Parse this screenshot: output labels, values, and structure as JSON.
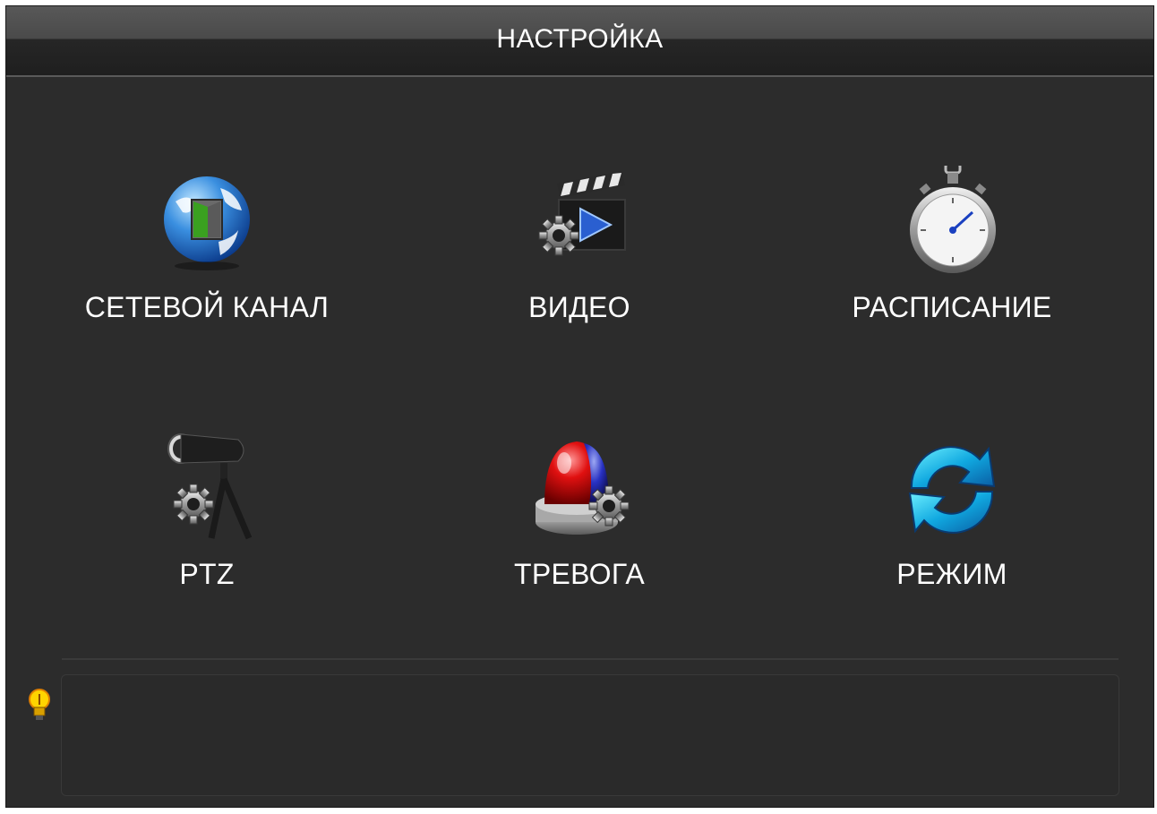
{
  "window": {
    "title": "НАСТРОЙКА"
  },
  "menu": {
    "items": [
      {
        "label": "СЕТЕВОЙ КАНАЛ",
        "icon": "network-globe-icon"
      },
      {
        "label": "ВИДЕО",
        "icon": "video-clapper-gear-icon"
      },
      {
        "label": "РАСПИСАНИЕ",
        "icon": "stopwatch-icon"
      },
      {
        "label": "PTZ",
        "icon": "ptz-camera-gear-icon"
      },
      {
        "label": "ТРЕВОГА",
        "icon": "alarm-siren-gear-icon"
      },
      {
        "label": "РЕЖИМ",
        "icon": "refresh-arrows-icon"
      }
    ]
  },
  "tip": {
    "icon": "lightbulb-icon",
    "text": ""
  },
  "colors": {
    "background": "#2c2c2c",
    "titlebar": "#262626",
    "text": "#ffffff"
  }
}
